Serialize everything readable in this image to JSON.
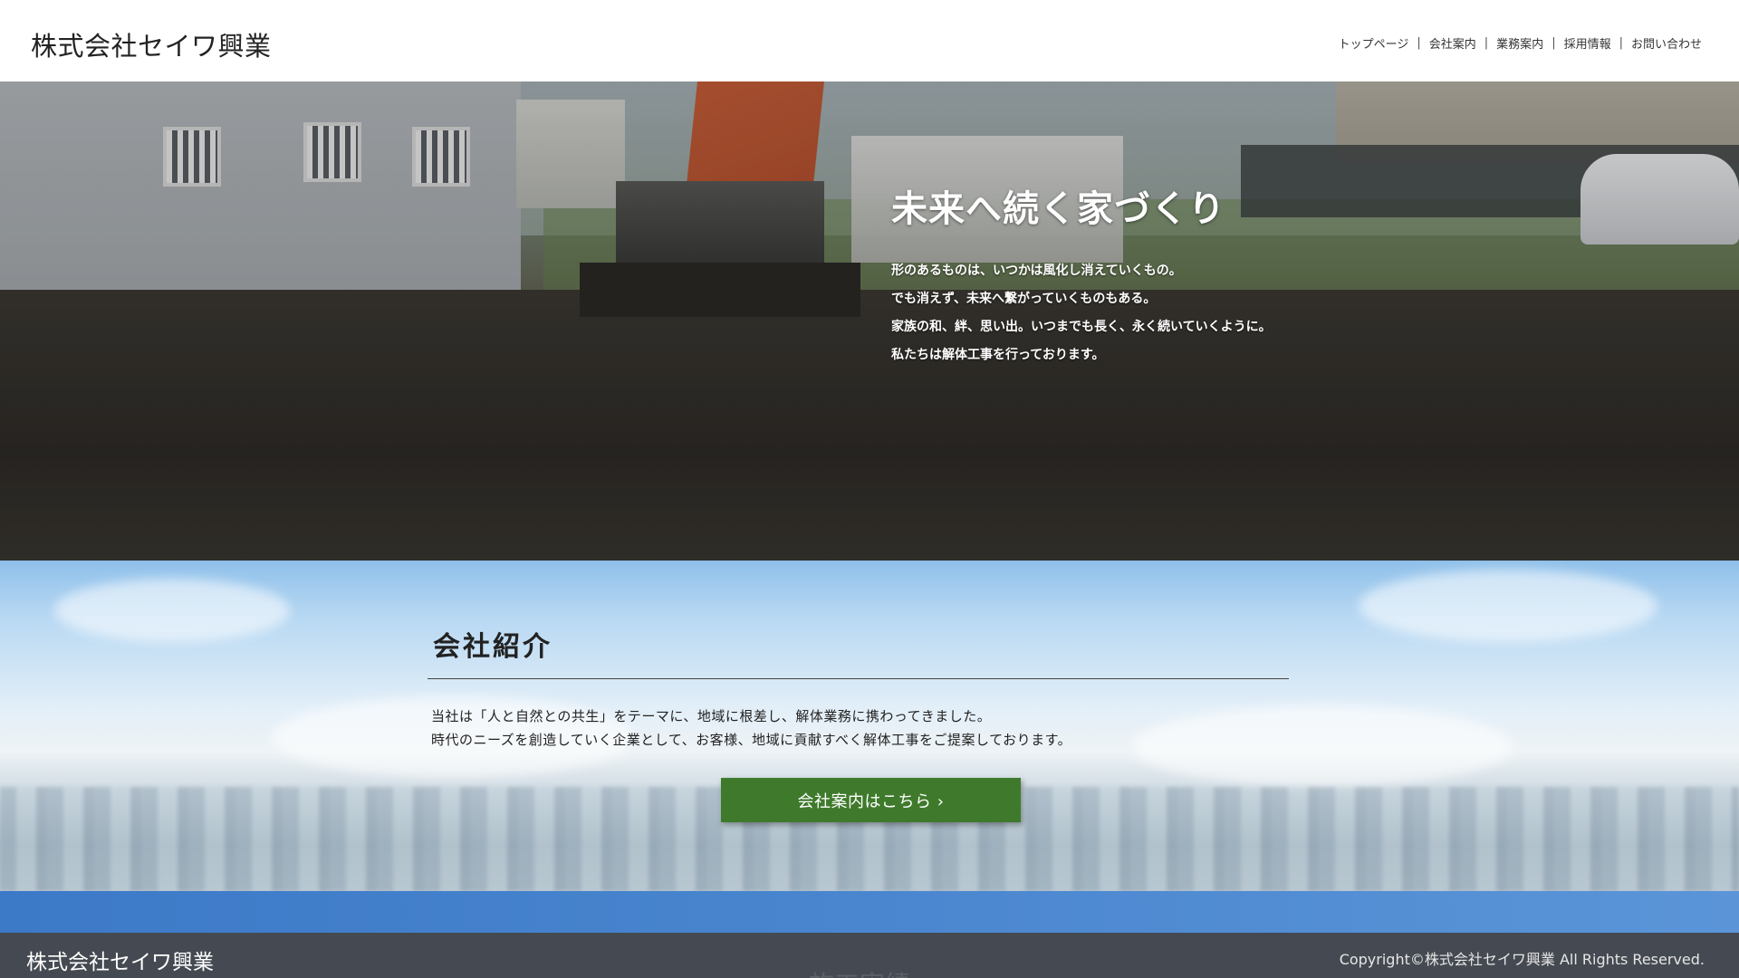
{
  "header": {
    "logo": "株式会社セイワ興業",
    "nav": [
      {
        "label": "トップページ"
      },
      {
        "label": "会社案内"
      },
      {
        "label": "業務案内"
      },
      {
        "label": "採用情報"
      },
      {
        "label": "お問い合わせ"
      }
    ],
    "separator": "|"
  },
  "hero": {
    "title": "未来へ続く家づくり",
    "lines": [
      "形のあるものは、いつかは風化し消えていくもの。",
      "でも消えず、未来へ繋がっていくものもある。",
      "家族の和、絆、思い出。いつまでも長く、永く続いていくように。",
      "私たちは解体工事を行っております。"
    ]
  },
  "about": {
    "heading": "会社紹介",
    "paragraphs": [
      "当社は「人と自然との共生」をテーマに、地域に根差し、解体業務に携わってきました。",
      "時代のニーズを創造していく企業として、お客様、地域に貢献すべく解体工事をご提案しております。"
    ],
    "button_label": "会社案内はこちら ›",
    "button_color": "#3f7a2c"
  },
  "footer": {
    "logo": "株式会社セイワ興業",
    "copyright": "Copyright©株式会社セイワ興業 All Rights Reserved.",
    "ghost_heading": "施工実績",
    "background_color": "#454a52"
  }
}
